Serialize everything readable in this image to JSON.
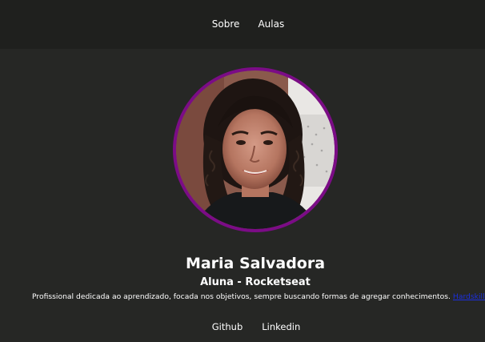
{
  "nav": {
    "items": [
      {
        "label": "Sobre"
      },
      {
        "label": "Aulas"
      }
    ]
  },
  "profile": {
    "name": "Maria Salvadora",
    "role": "Aluna - Rocketseat",
    "bio": "Profissional dedicada ao aprendizado, focada nos objetivos, sempre buscando formas de agregar conhecimentos.",
    "bio_link": "Hardskills",
    "avatar_ring_color": "#7b0c86"
  },
  "social": {
    "items": [
      {
        "label": "Github"
      },
      {
        "label": "Linkedin"
      }
    ]
  },
  "colors": {
    "header_bg": "#1f201e",
    "page_bg": "#262725",
    "link": "#1b2fe0"
  }
}
